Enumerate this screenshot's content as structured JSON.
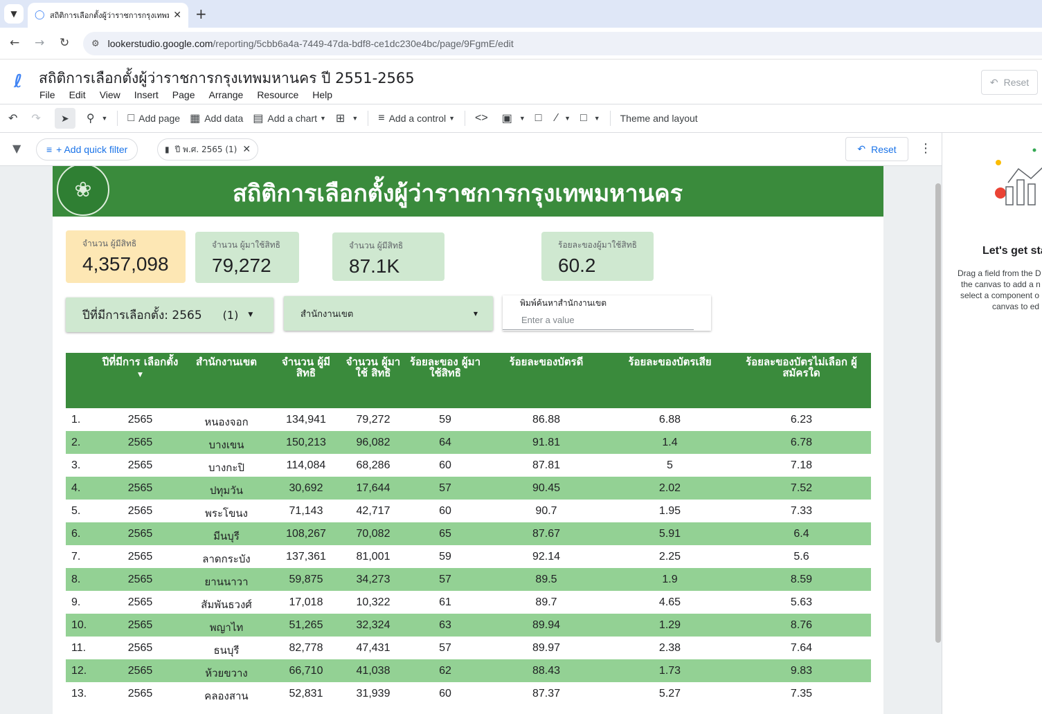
{
  "browser": {
    "tab_title": "สถิติการเลือกตั้งผู้ว่าราชการกรุงเทพม",
    "url_host": "lookerstudio.google.com",
    "url_path": "/reporting/5cbb6a4a-7449-47da-bdf8-ce1dc230e4bc/page/9FgmE/edit"
  },
  "app": {
    "doc_title": "สถิติการเลือกตั้งผู้ว่าราชการกรุงเทพมหานคร ปี 2551-2565",
    "menu": [
      "File",
      "Edit",
      "View",
      "Insert",
      "Page",
      "Arrange",
      "Resource",
      "Help"
    ],
    "reset_label": "Reset"
  },
  "toolbar": {
    "add_page": "Add page",
    "add_data": "Add data",
    "add_chart": "Add a chart",
    "add_control": "Add a control",
    "theme_layout": "Theme and layout"
  },
  "filterbar": {
    "quick_filter": "+ Add quick filter",
    "chip_label": "ปี พ.ศ. 2565 (1)",
    "reset_label": "Reset"
  },
  "report": {
    "banner_title": "สถิติการเลือกตั้งผู้ว่าราชการกรุงเทพมหานคร",
    "kpis": [
      {
        "label": "จำนวน ผู้มีสิทธิ",
        "value": "4,357,098"
      },
      {
        "label": "จำนวน ผู้มาใช้สิทธิ",
        "value": "79,272"
      },
      {
        "label": "จำนวน ผู้มีสิทธิ",
        "value": "87.1K"
      },
      {
        "label": "ร้อยละของผู้มาใช้สิทธิ",
        "value": "60.2"
      }
    ],
    "controls": {
      "year_label": "ปีที่มีการเลือกตั้ง: 2565",
      "year_count": "(1)",
      "district_label": "สำนักงานเขต",
      "search_label": "พิมพ์ค้นหาสำนักงานเขต",
      "search_placeholder": "Enter a value"
    },
    "table": {
      "headers": [
        "ปีที่มีการ เลือกตั้ง",
        "สำนักงานเขต",
        "จำนวน ผู้มีสิทธิ",
        "จำนวน ผู้มาใช้ สิทธิ",
        "ร้อยละของ ผู้มาใช้สิทธิ",
        "ร้อยละของบัตรดี",
        "ร้อยละของบัตรเสีย",
        "ร้อยละของบัตรไม่เลือก ผู้สมัครใด"
      ],
      "rows": [
        [
          "1.",
          "2565",
          "หนองจอก",
          "134,941",
          "79,272",
          "59",
          "86.88",
          "6.88",
          "6.23"
        ],
        [
          "2.",
          "2565",
          "บางเขน",
          "150,213",
          "96,082",
          "64",
          "91.81",
          "1.4",
          "6.78"
        ],
        [
          "3.",
          "2565",
          "บางกะปิ",
          "114,084",
          "68,286",
          "60",
          "87.81",
          "5",
          "7.18"
        ],
        [
          "4.",
          "2565",
          "ปทุมวัน",
          "30,692",
          "17,644",
          "57",
          "90.45",
          "2.02",
          "7.52"
        ],
        [
          "5.",
          "2565",
          "พระโขนง",
          "71,143",
          "42,717",
          "60",
          "90.7",
          "1.95",
          "7.33"
        ],
        [
          "6.",
          "2565",
          "มีนบุรี",
          "108,267",
          "70,082",
          "65",
          "87.67",
          "5.91",
          "6.4"
        ],
        [
          "7.",
          "2565",
          "ลาดกระบัง",
          "137,361",
          "81,001",
          "59",
          "92.14",
          "2.25",
          "5.6"
        ],
        [
          "8.",
          "2565",
          "ยานนาวา",
          "59,875",
          "34,273",
          "57",
          "89.5",
          "1.9",
          "8.59"
        ],
        [
          "9.",
          "2565",
          "สัมพันธวงศ์",
          "17,018",
          "10,322",
          "61",
          "89.7",
          "4.65",
          "5.63"
        ],
        [
          "10.",
          "2565",
          "พญาไท",
          "51,265",
          "32,324",
          "63",
          "89.94",
          "1.29",
          "8.76"
        ],
        [
          "11.",
          "2565",
          "ธนบุรี",
          "82,778",
          "47,431",
          "57",
          "89.97",
          "2.38",
          "7.64"
        ],
        [
          "12.",
          "2565",
          "ห้วยขวาง",
          "66,710",
          "41,038",
          "62",
          "88.43",
          "1.73",
          "9.83"
        ],
        [
          "13.",
          "2565",
          "คลองสาน",
          "52,831",
          "31,939",
          "60",
          "87.37",
          "5.27",
          "7.35"
        ]
      ]
    }
  },
  "right_panel": {
    "title": "Let's get sta",
    "lines": [
      "Drag a field from the D",
      "the canvas to add a n",
      "select a component o",
      "canvas to ed"
    ]
  },
  "colors": {
    "header_green": "#3a8b3c",
    "row_alt_green": "#93d194",
    "kpi_yellow": "#fde7b4",
    "kpi_green": "#cfe8d0",
    "accent_blue": "#1a73e8"
  }
}
